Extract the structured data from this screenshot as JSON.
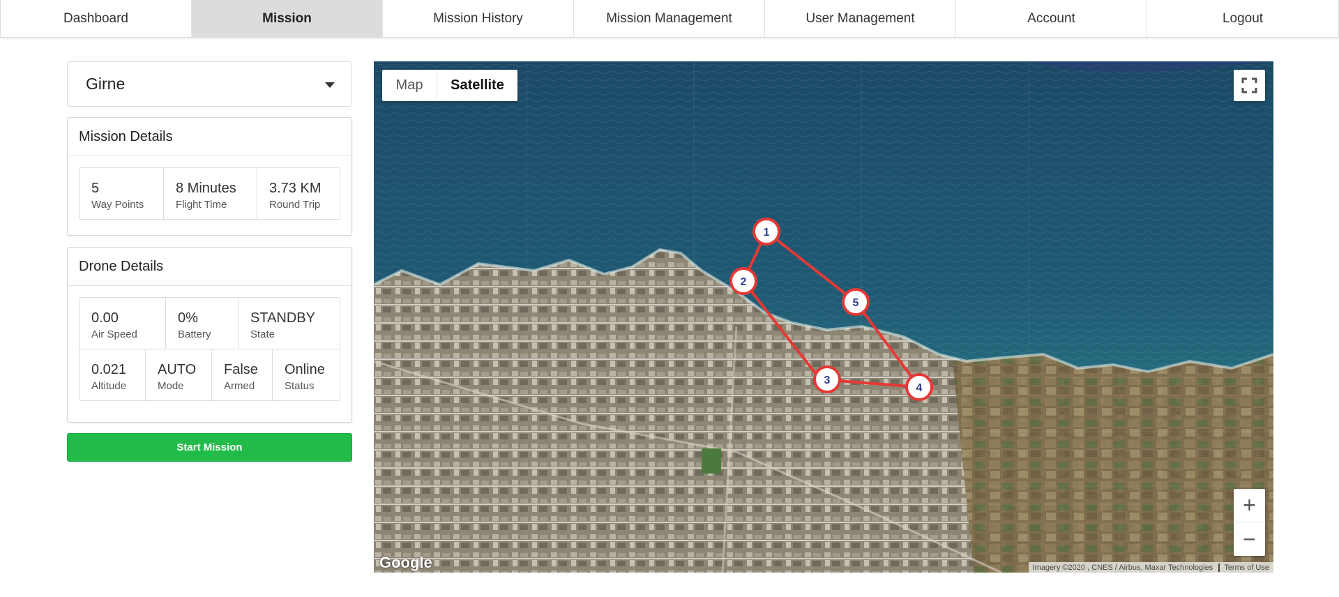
{
  "nav": {
    "items": [
      {
        "label": "Dashboard",
        "active": false
      },
      {
        "label": "Mission",
        "active": true
      },
      {
        "label": "Mission History",
        "active": false
      },
      {
        "label": "Mission Management",
        "active": false
      },
      {
        "label": "User Management",
        "active": false
      },
      {
        "label": "Account",
        "active": false
      },
      {
        "label": "Logout",
        "active": false
      }
    ]
  },
  "city_select": {
    "value": "Girne"
  },
  "mission_details": {
    "title": "Mission Details",
    "stats": [
      {
        "value": "5",
        "label": "Way Points"
      },
      {
        "value": "8 Minutes",
        "label": "Flight Time"
      },
      {
        "value": "3.73 KM",
        "label": "Round Trip"
      }
    ]
  },
  "drone_details": {
    "title": "Drone Details",
    "row1": [
      {
        "value": "0.00",
        "label": "Air Speed"
      },
      {
        "value": "0%",
        "label": "Battery"
      },
      {
        "value": "STANDBY",
        "label": "State"
      }
    ],
    "row2": [
      {
        "value": "0.021",
        "label": "Altitude"
      },
      {
        "value": "AUTO",
        "label": "Mode"
      },
      {
        "value": "False",
        "label": "Armed"
      },
      {
        "value": "Online",
        "label": "Status"
      }
    ]
  },
  "start_button": {
    "label": "Start Mission"
  },
  "map": {
    "type_map_label": "Map",
    "type_satellite_label": "Satellite",
    "zoom_in_label": "+",
    "zoom_out_label": "−",
    "google_label": "Google",
    "attribution": "Imagery ©2020 , CNES / Airbus, Maxar Technologies",
    "terms": "Terms of Use",
    "waypoints": [
      {
        "label": "1"
      },
      {
        "label": "2"
      },
      {
        "label": "3"
      },
      {
        "label": "4"
      },
      {
        "label": "5"
      }
    ],
    "route_color": "#e53935",
    "marker_text_color": "#2f3b8c"
  }
}
